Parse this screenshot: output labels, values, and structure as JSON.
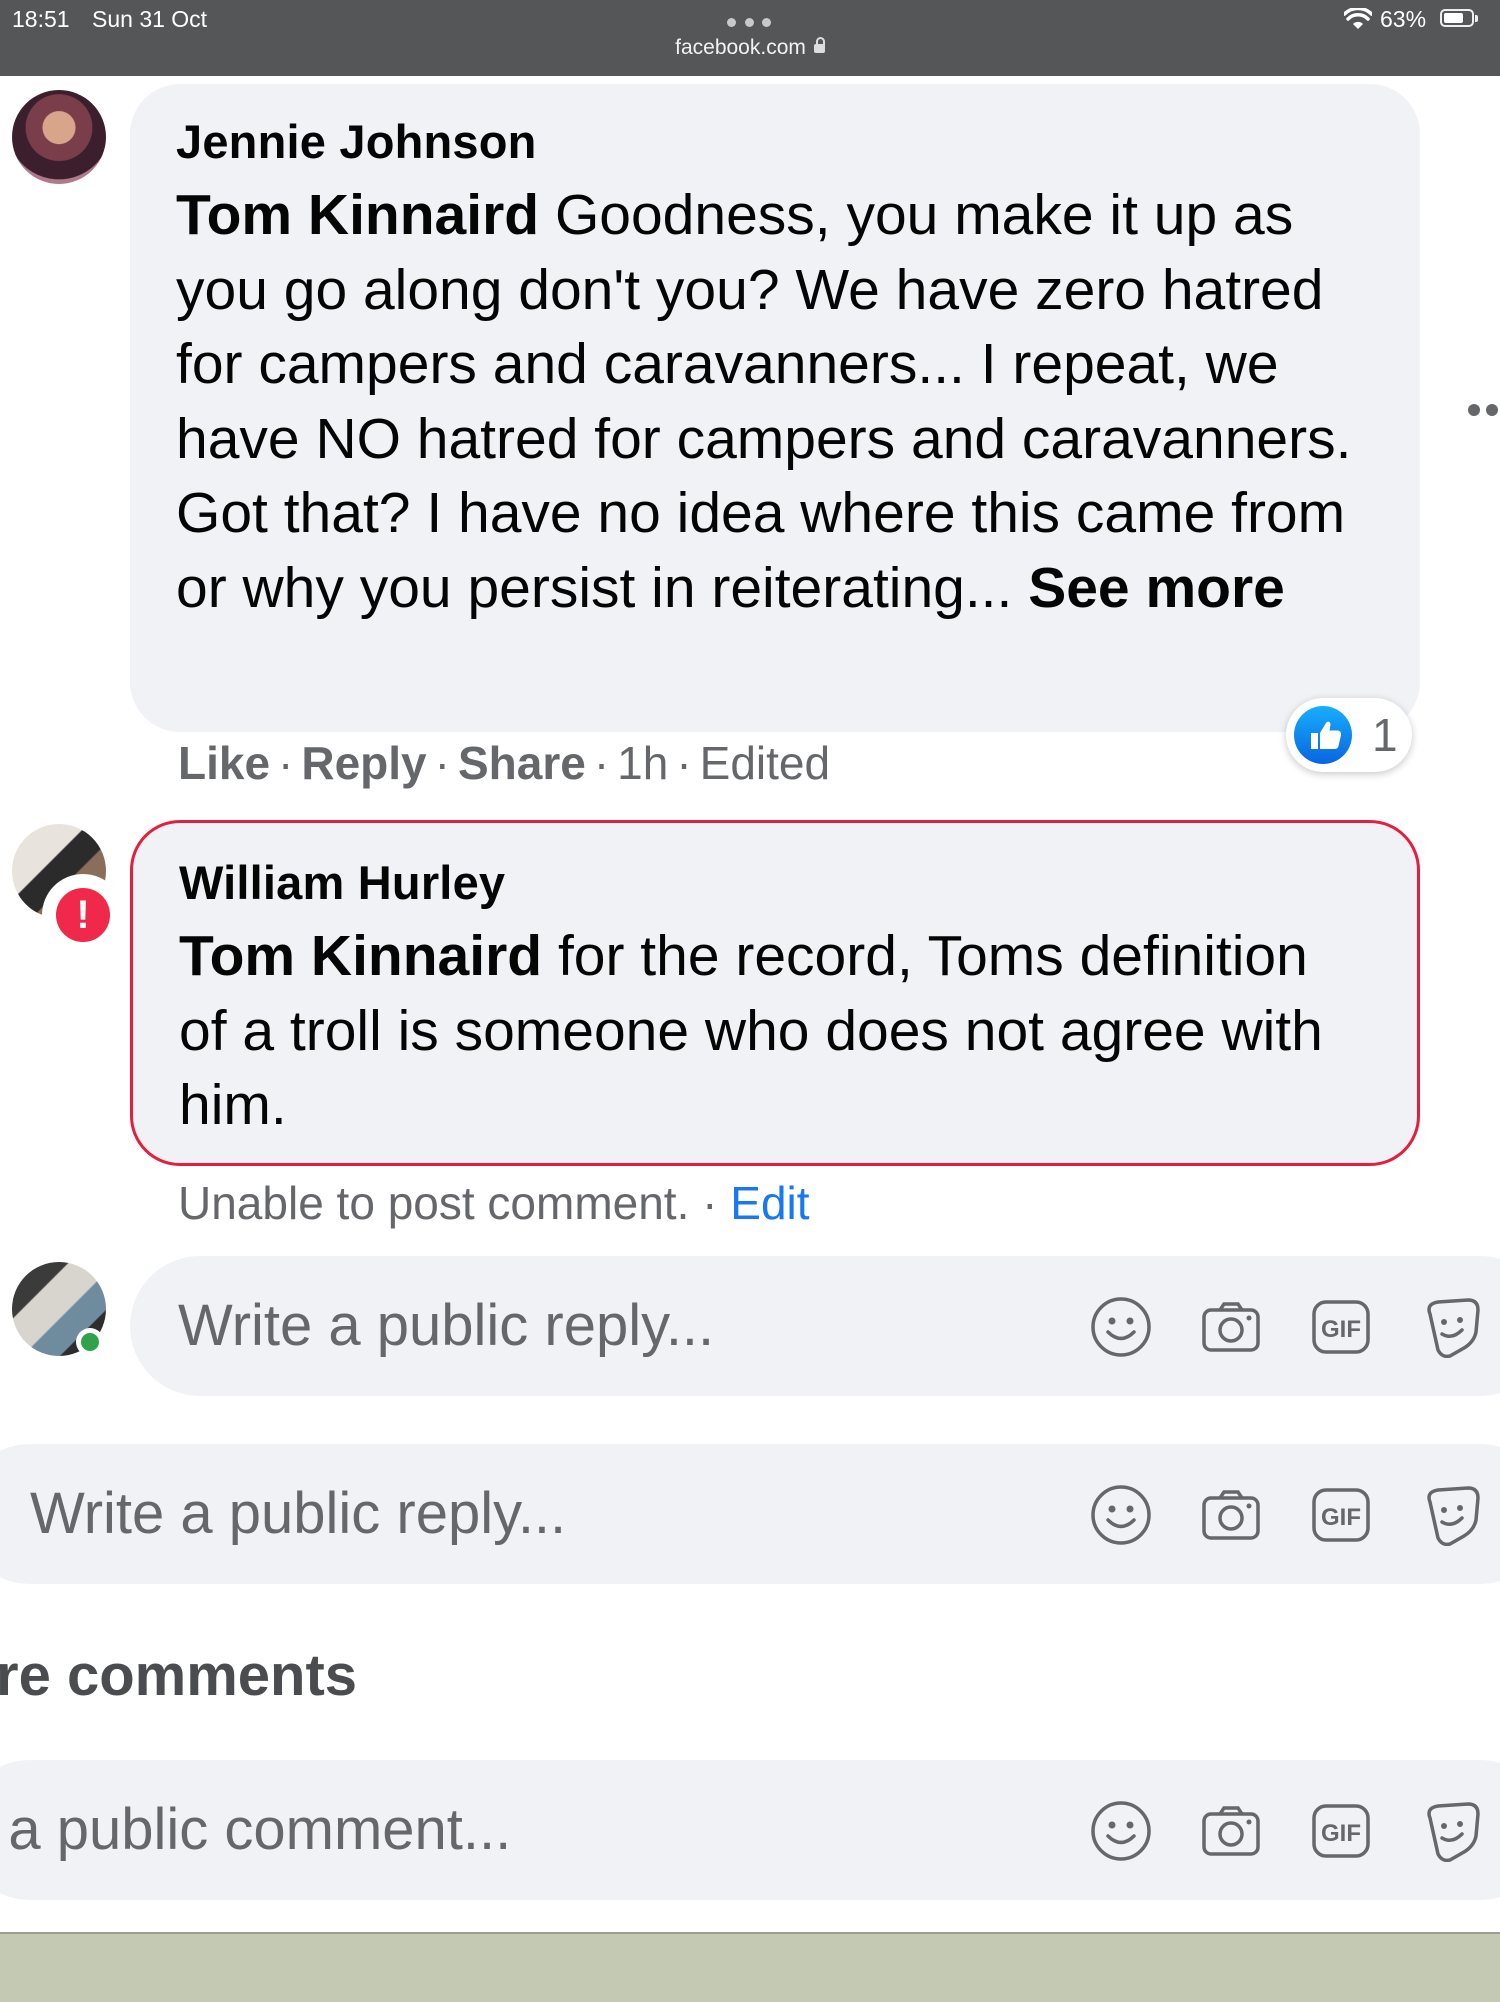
{
  "status_bar": {
    "time": "18:51",
    "date": "Sun 31 Oct",
    "url": "facebook.com",
    "battery": "63%"
  },
  "comments": [
    {
      "author": "Jennie Johnson",
      "mention": "Tom Kinnaird",
      "text": " Goodness, you make it up as you go along don't you? We have zero hatred for campers and caravanners... I repeat, we have NO hatred for campers and caravanners. Got that? I have no idea where this came from or why you persist in reiterating... ",
      "see_more": "See more",
      "actions": {
        "like": "Like",
        "reply": "Reply",
        "share": "Share",
        "time": "1h",
        "edited": "Edited"
      },
      "reaction_count": "1"
    },
    {
      "author": "William Hurley",
      "mention": "Tom Kinnaird",
      "text": " for the record, Toms definition of a troll is someone who does not agree with him.",
      "error": "Unable to post comment.",
      "edit": "Edit"
    }
  ],
  "reply_inputs": [
    {
      "placeholder": "Write a public reply..."
    },
    {
      "placeholder": "Write a public reply..."
    }
  ],
  "more_comments_label": "re comments",
  "comment_input": {
    "placeholder": "e a public comment..."
  },
  "icons": [
    "emoji-icon",
    "camera-icon",
    "gif-icon",
    "sticker-icon"
  ],
  "colors": {
    "bubble": "#f0f2f5",
    "error_border": "#e41e3f",
    "link_blue": "#1877f2",
    "meta_grey": "#65676b",
    "status_bar": "#555658"
  }
}
